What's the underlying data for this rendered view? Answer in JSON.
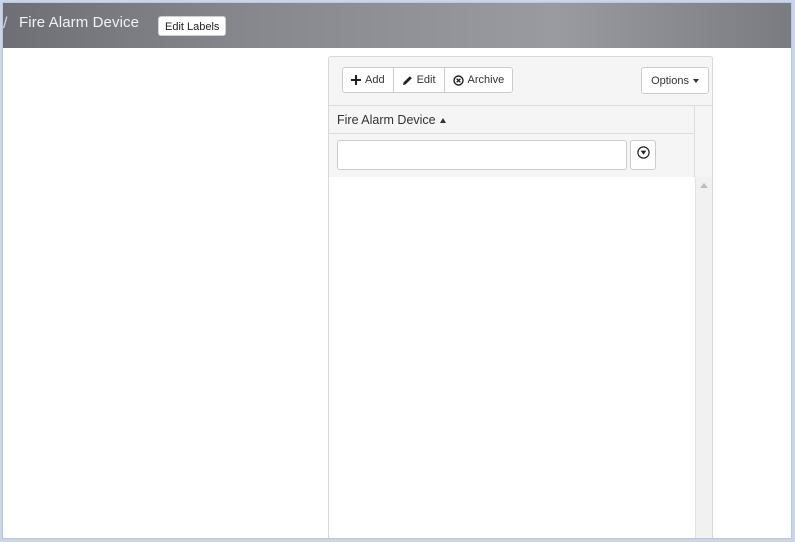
{
  "header": {
    "breadcrumb_separator": "/",
    "title": "Fire Alarm Device",
    "edit_labels": "Edit Labels"
  },
  "toolbar": {
    "add_label": "Add",
    "edit_label": "Edit",
    "archive_label": "Archive",
    "options_label": "Options"
  },
  "grid": {
    "column_header": "Fire Alarm Device",
    "filter_value": "",
    "filter_placeholder": ""
  }
}
